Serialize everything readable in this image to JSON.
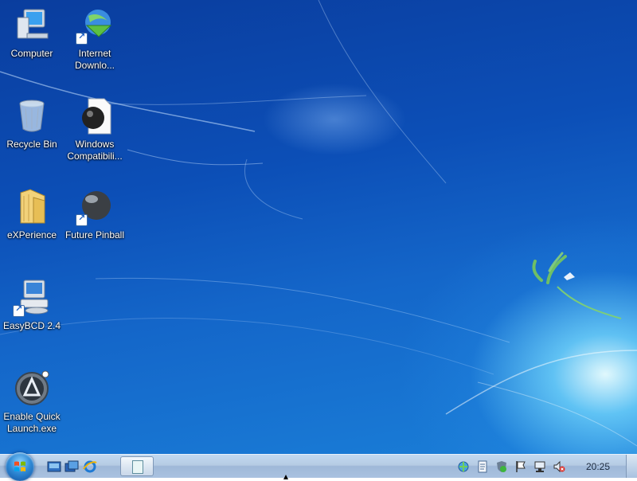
{
  "desktop": {
    "icons": [
      {
        "label": "Computer",
        "icon": "computer-icon"
      },
      {
        "label": "Internet\nDownlo...",
        "icon": "internet-download-manager-icon"
      },
      {
        "label": "Recycle Bin",
        "icon": "recycle-bin-icon"
      },
      {
        "label": "Windows\nCompatibili...",
        "icon": "windows-compatibility-icon"
      },
      {
        "label": "eXPerience",
        "icon": "folder-icon"
      },
      {
        "label": "Future Pinball",
        "icon": "future-pinball-icon"
      },
      {
        "label": "EasyBCD 2.4",
        "icon": "easybcd-icon"
      },
      {
        "label": "Enable Quick\nLaunch.exe",
        "icon": "enable-quick-launch-icon"
      }
    ]
  },
  "taskbar": {
    "start_icon": "windows-start-orb-icon",
    "quick_launch": [
      "show-desktop-icon",
      "switch-windows-icon",
      "internet-explorer-icon"
    ],
    "open_item_icon": "notepad-icon",
    "tray_icons": [
      "network-globe-icon",
      "document-icon",
      "security-shield-icon",
      "action-center-flag-icon",
      "network-icon",
      "volume-muted-icon"
    ],
    "clock": "20:25"
  },
  "colors": {
    "desktop_dark": "#0a3d9e",
    "desktop_light": "#1a7fd8",
    "glow": "#e6ffff",
    "taskbar": "#b6cbe4"
  }
}
